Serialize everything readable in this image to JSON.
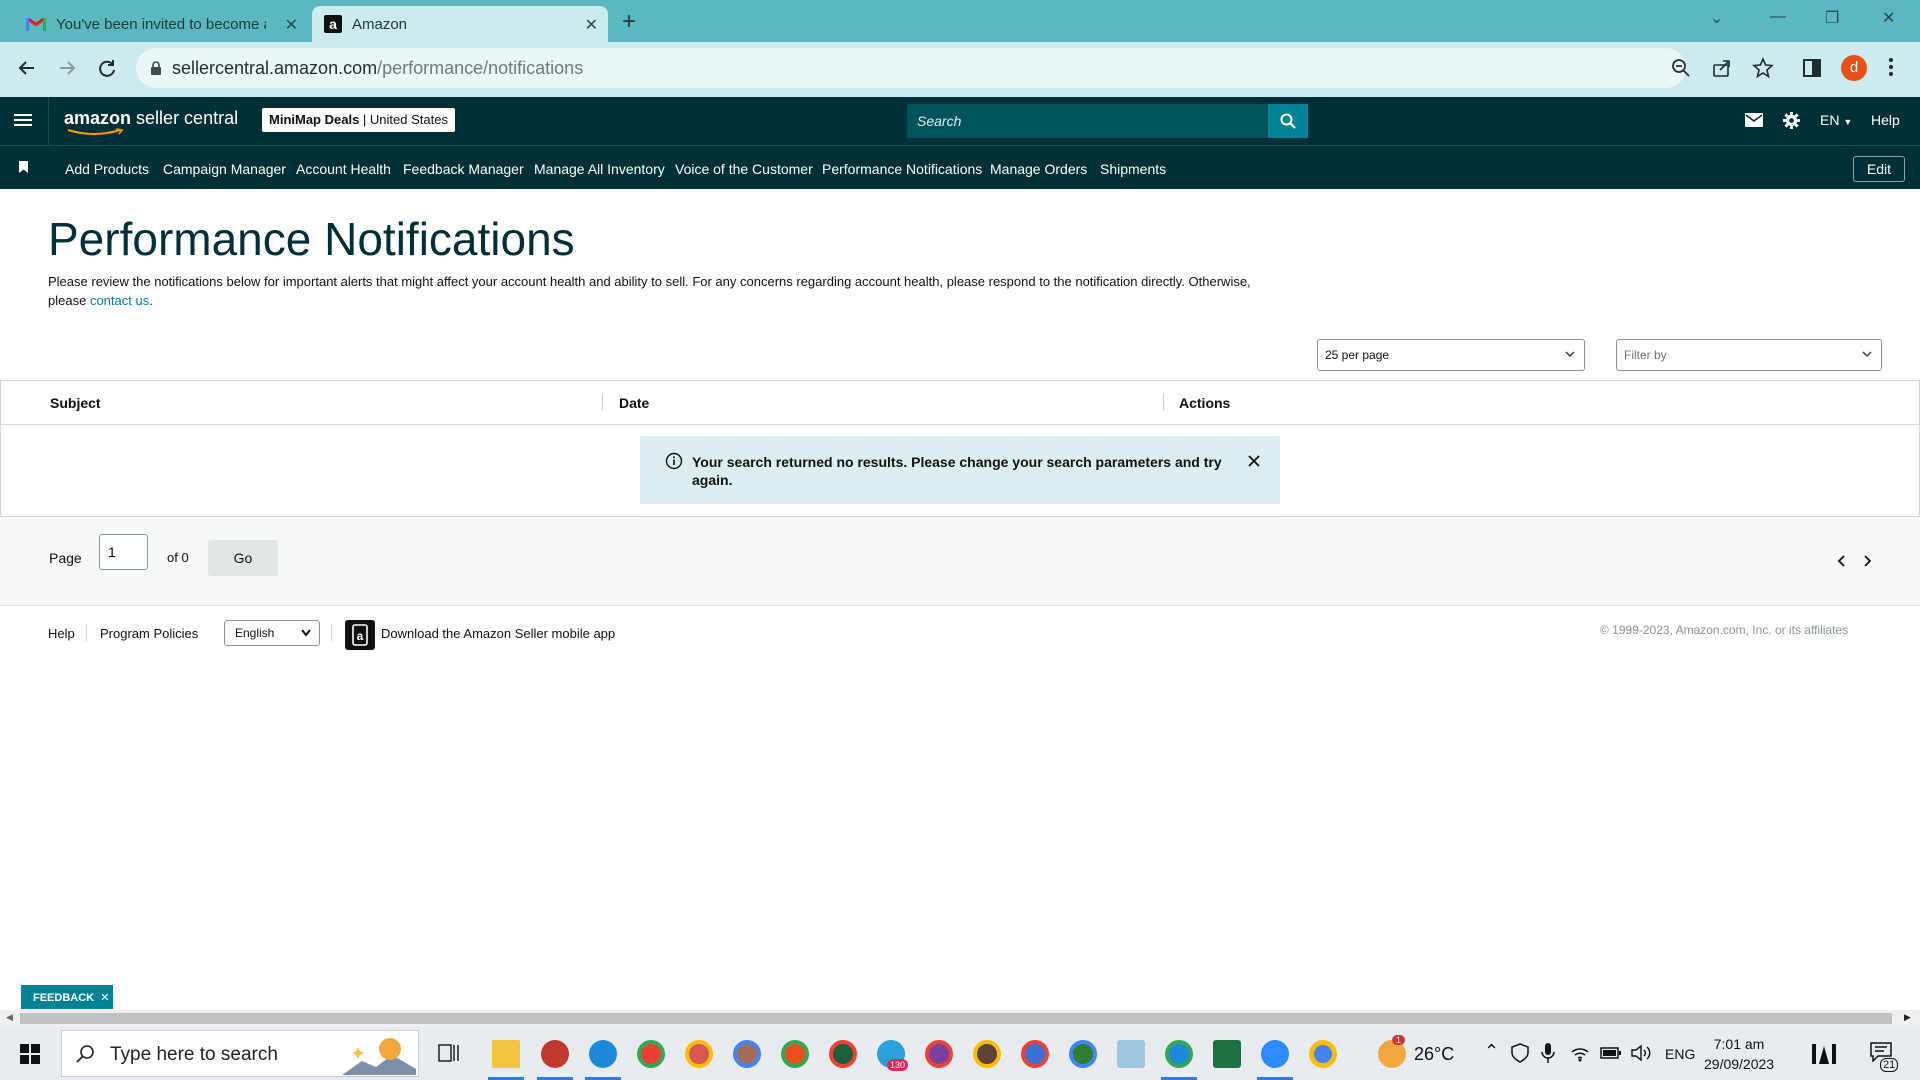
{
  "browser": {
    "tabs": [
      {
        "title": "You've been invited to become a",
        "active": false,
        "icon": "gmail-icon"
      },
      {
        "title": "Amazon",
        "active": true,
        "icon": "amazon-icon"
      }
    ],
    "url_host": "sellercentral.amazon.com",
    "url_path": "/performance/notifications",
    "profile_initial": "d"
  },
  "header": {
    "logo_brand": "amazon",
    "logo_text": "seller central",
    "store_name": "MiniMap Deals",
    "store_region": "United States",
    "search_placeholder": "Search",
    "language": "EN",
    "help": "Help"
  },
  "nav": {
    "items": [
      "Add Products",
      "Campaign Manager",
      "Account Health",
      "Feedback Manager",
      "Manage All Inventory",
      "Voice of the Customer",
      "Performance Notifications",
      "Manage Orders",
      "Shipments"
    ],
    "edit_label": "Edit"
  },
  "page": {
    "title": "Performance Notifications",
    "description": "Please review the notifications below for important alerts that might affect your account health and ability to sell. For any concerns regarding account health, please respond to the notification directly. Otherwise, please",
    "contact_link": "contact us",
    "per_page": "25 per page",
    "filter_placeholder": "Filter by"
  },
  "table": {
    "columns": [
      "Subject",
      "Date",
      "Actions"
    ],
    "empty_message": "Your search returned no results. Please change your search parameters and try again."
  },
  "pager": {
    "page_label": "Page",
    "page_value": "1",
    "of_label": "of 0",
    "go_label": "Go"
  },
  "footer": {
    "help": "Help",
    "program_policies": "Program Policies",
    "language": "English",
    "download_app": "Download the Amazon Seller mobile app",
    "copyright": "© 1999-2023, Amazon.com, Inc. or its affiliates"
  },
  "feedback_label": "FEEDBACK",
  "taskbar": {
    "search_placeholder": "Type here to search",
    "temperature": "26°C",
    "language": "ENG",
    "time": "7:01 am",
    "date": "29/09/2023",
    "telegram_badge": "130",
    "notifications_count": "21",
    "weather_badge": "1"
  },
  "colors": {
    "header_bg": "#002f36",
    "accent": "#008296",
    "chrome_tabbar": "#5bb8c1",
    "alert_bg": "#dbeef0"
  }
}
